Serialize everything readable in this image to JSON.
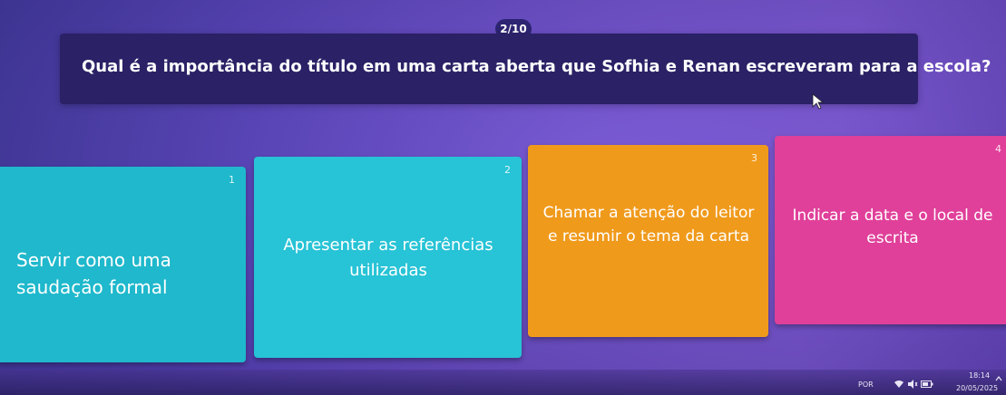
{
  "quiz": {
    "progress": "2/10",
    "question": "Qual é a importância do título em uma carta aberta que Sofhia e Renan escreveram para a escola?",
    "options": [
      {
        "number": "1",
        "text": "Servir como uma saudação formal",
        "color": "#1fb8cc"
      },
      {
        "number": "2",
        "text": "Apresentar as referências utilizadas",
        "color": "#27c3d6"
      },
      {
        "number": "3",
        "text": "Chamar a atenção do leitor e resumir o tema da carta",
        "color": "#f09a1c"
      },
      {
        "number": "4",
        "text": "Indicar a data e o local de escrita",
        "color": "#e0409a"
      }
    ]
  },
  "taskbar": {
    "language": "POR",
    "time": "18:14",
    "date": "20/05/2025",
    "icons": [
      "wifi-icon",
      "volume-icon",
      "battery-icon",
      "chevron-up-icon"
    ]
  }
}
